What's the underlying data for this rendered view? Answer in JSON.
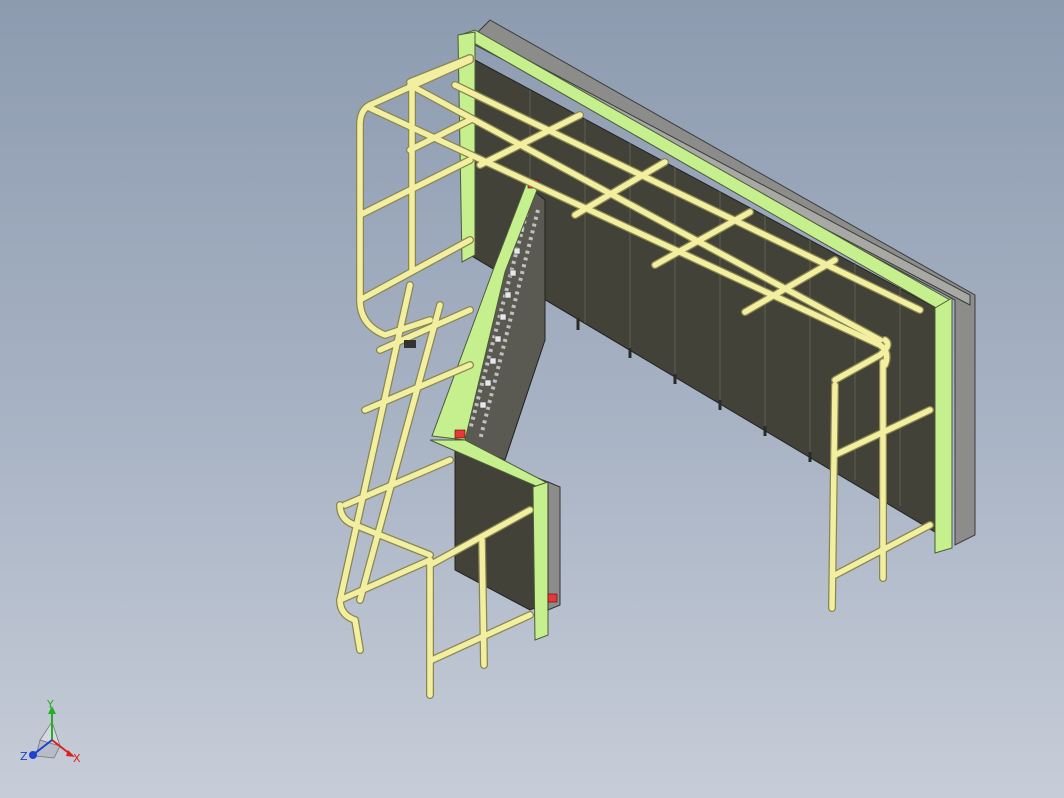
{
  "colors": {
    "background_top": "#8d9bb0",
    "background_bottom": "#c7cdd8",
    "rail": "#f3efa0",
    "rail_outline": "#8a8650",
    "frame_green": "#c6f08e",
    "frame_outline": "#4c5a3a",
    "panel_dark": "#424238",
    "steel_gray": "#8c8c8a",
    "marker_red": "#e23a3a",
    "axis_x": "#e02020",
    "axis_y": "#20b020",
    "axis_z": "#2040d0"
  },
  "triad": {
    "x_label": "X",
    "y_label": "Y",
    "z_label": "Z"
  },
  "model": {
    "icon": "3d-assembly-icon"
  }
}
